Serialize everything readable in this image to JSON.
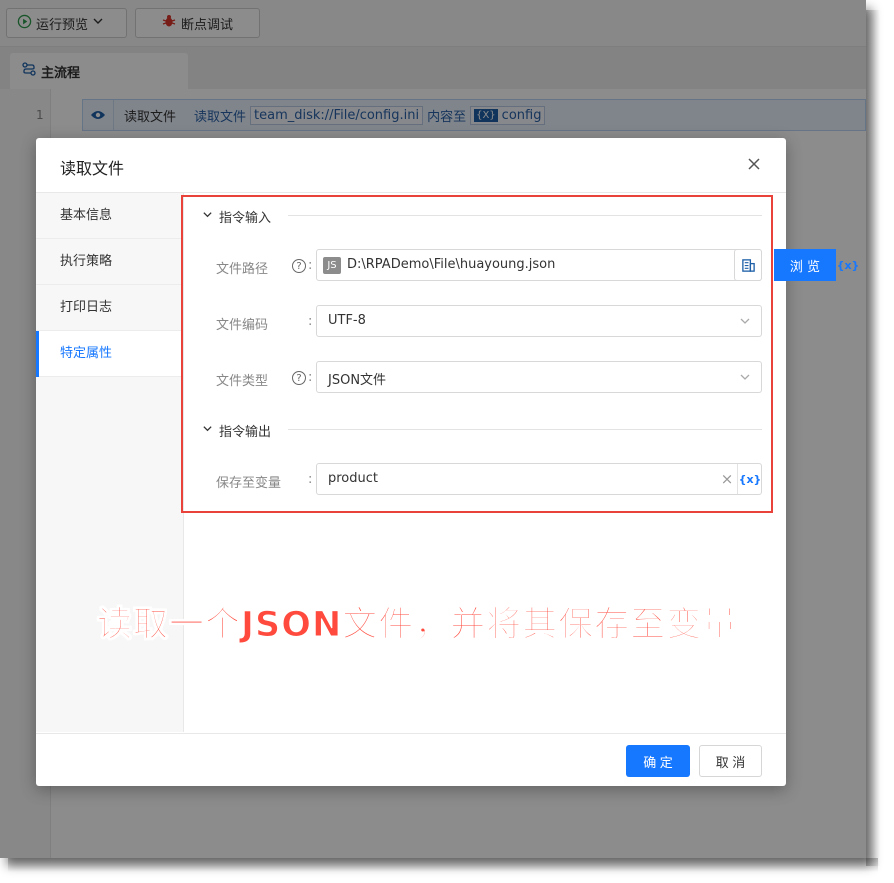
{
  "toolbar": {
    "run_preview_label": "运行预览",
    "debug_label": "断点调试"
  },
  "tabs": {
    "main_flow": "主流程"
  },
  "editor": {
    "line_number": "1",
    "step": {
      "name": "读取文件",
      "action": "读取文件",
      "path_tag": "team_disk://File/config.ini",
      "content_to": "内容至",
      "var_icon": "{X}",
      "var_name": "config"
    }
  },
  "modal": {
    "title": "读取文件",
    "sidebar": [
      {
        "label": "基本信息",
        "active": false
      },
      {
        "label": "执行策略",
        "active": false
      },
      {
        "label": "打印日志",
        "active": false
      },
      {
        "label": "特定属性",
        "active": true
      }
    ],
    "input_section": {
      "title": "指令输入"
    },
    "output_section": {
      "title": "指令输出"
    },
    "fields": {
      "file_path": {
        "label": "文件路径",
        "badge": "JS",
        "value": "D:\\RPADemo\\File\\huayoung.json",
        "browse_label": "浏 览",
        "var_label": "{x}"
      },
      "encoding": {
        "label": "文件编码",
        "value": "UTF-8"
      },
      "file_type": {
        "label": "文件类型",
        "value": "JSON文件"
      },
      "save_var": {
        "label": "保存至变量",
        "value": "product",
        "clear": "×",
        "var_label": "{x}"
      }
    },
    "footer": {
      "ok_label": "确 定",
      "cancel_label": "取 消"
    }
  },
  "caption": "读取一个JSON文件，并将其保存至变量",
  "colors": {
    "accent": "#1677ff",
    "highlight": "#e8423b",
    "caption": "#ff4a3d"
  },
  "icons": [
    "play-circle-icon",
    "chevron-down-icon",
    "bug-icon",
    "flow-icon",
    "eye-icon",
    "close-icon",
    "help-icon",
    "building-icon",
    "clear-icon"
  ]
}
